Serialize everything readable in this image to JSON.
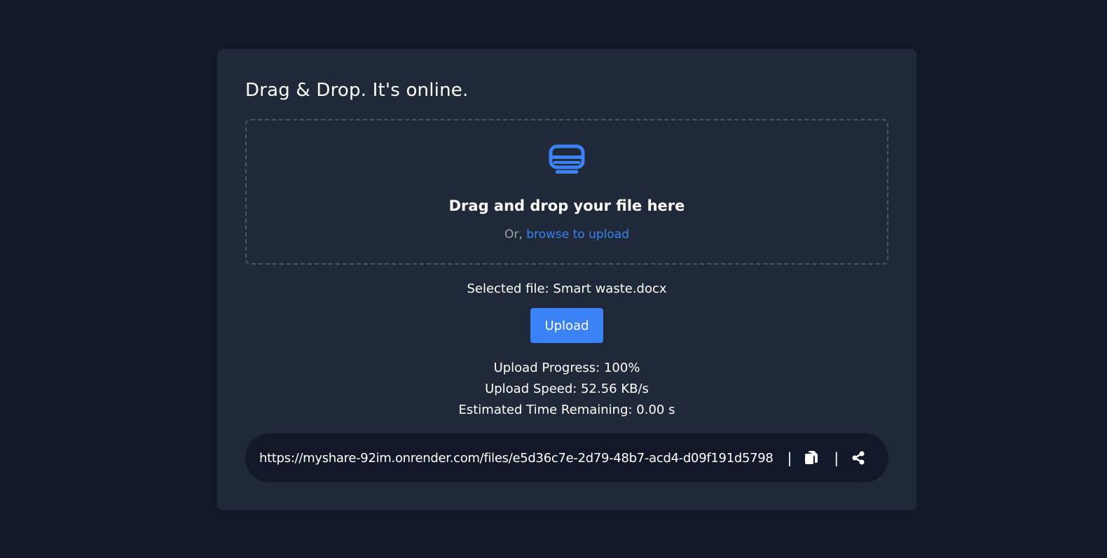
{
  "header": {
    "title": "Drag & Drop. It's online."
  },
  "dropzone": {
    "icon": "upload-tray-icon",
    "heading": "Drag and drop your file here",
    "prefix": "Or,",
    "browse_link": "browse to upload"
  },
  "file": {
    "selected_text": "Selected file: Smart waste.docx"
  },
  "actions": {
    "upload_label": "Upload"
  },
  "stats": {
    "progress": "Upload Progress: 100%",
    "speed": "Upload Speed: 52.56 KB/s",
    "eta": "Estimated Time Remaining: 0.00 s"
  },
  "share": {
    "url": "https://myshare-92im.onrender.com/files/e5d36c7e-2d79-48b7-acd4-d09f191d5798",
    "separator": "|",
    "copy_icon": "copy-icon",
    "share_icon": "share-icon"
  },
  "colors": {
    "background": "#111827",
    "card": "#1f2937",
    "accent": "#3b82f6",
    "muted_text": "#9ca3af"
  }
}
